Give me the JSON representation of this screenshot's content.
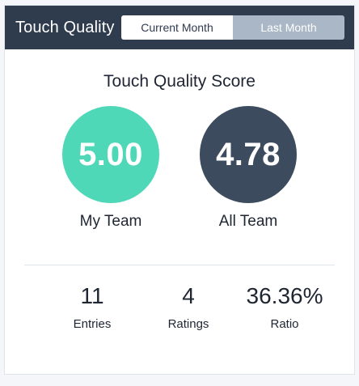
{
  "header": {
    "title": "Touch Quality",
    "tabs": [
      {
        "label": "Current Month",
        "active": true
      },
      {
        "label": "Last Month",
        "active": false
      }
    ]
  },
  "score_section": {
    "title": "Touch Quality Score",
    "my_team": {
      "value": "5.00",
      "label": "My Team",
      "color": "#4fd8b8"
    },
    "all_team": {
      "value": "4.78",
      "label": "All Team",
      "color": "#3c4b5e"
    }
  },
  "stats": {
    "entries": {
      "value": "11",
      "label": "Entries"
    },
    "ratings": {
      "value": "4",
      "label": "Ratings"
    },
    "ratio": {
      "value": "36.36%",
      "label": "Ratio"
    }
  },
  "colors": {
    "header_bg": "#2f3c4e",
    "tab_inactive_bg": "#a9b7c6",
    "teal": "#4fd8b8",
    "slate": "#3c4b5e"
  }
}
